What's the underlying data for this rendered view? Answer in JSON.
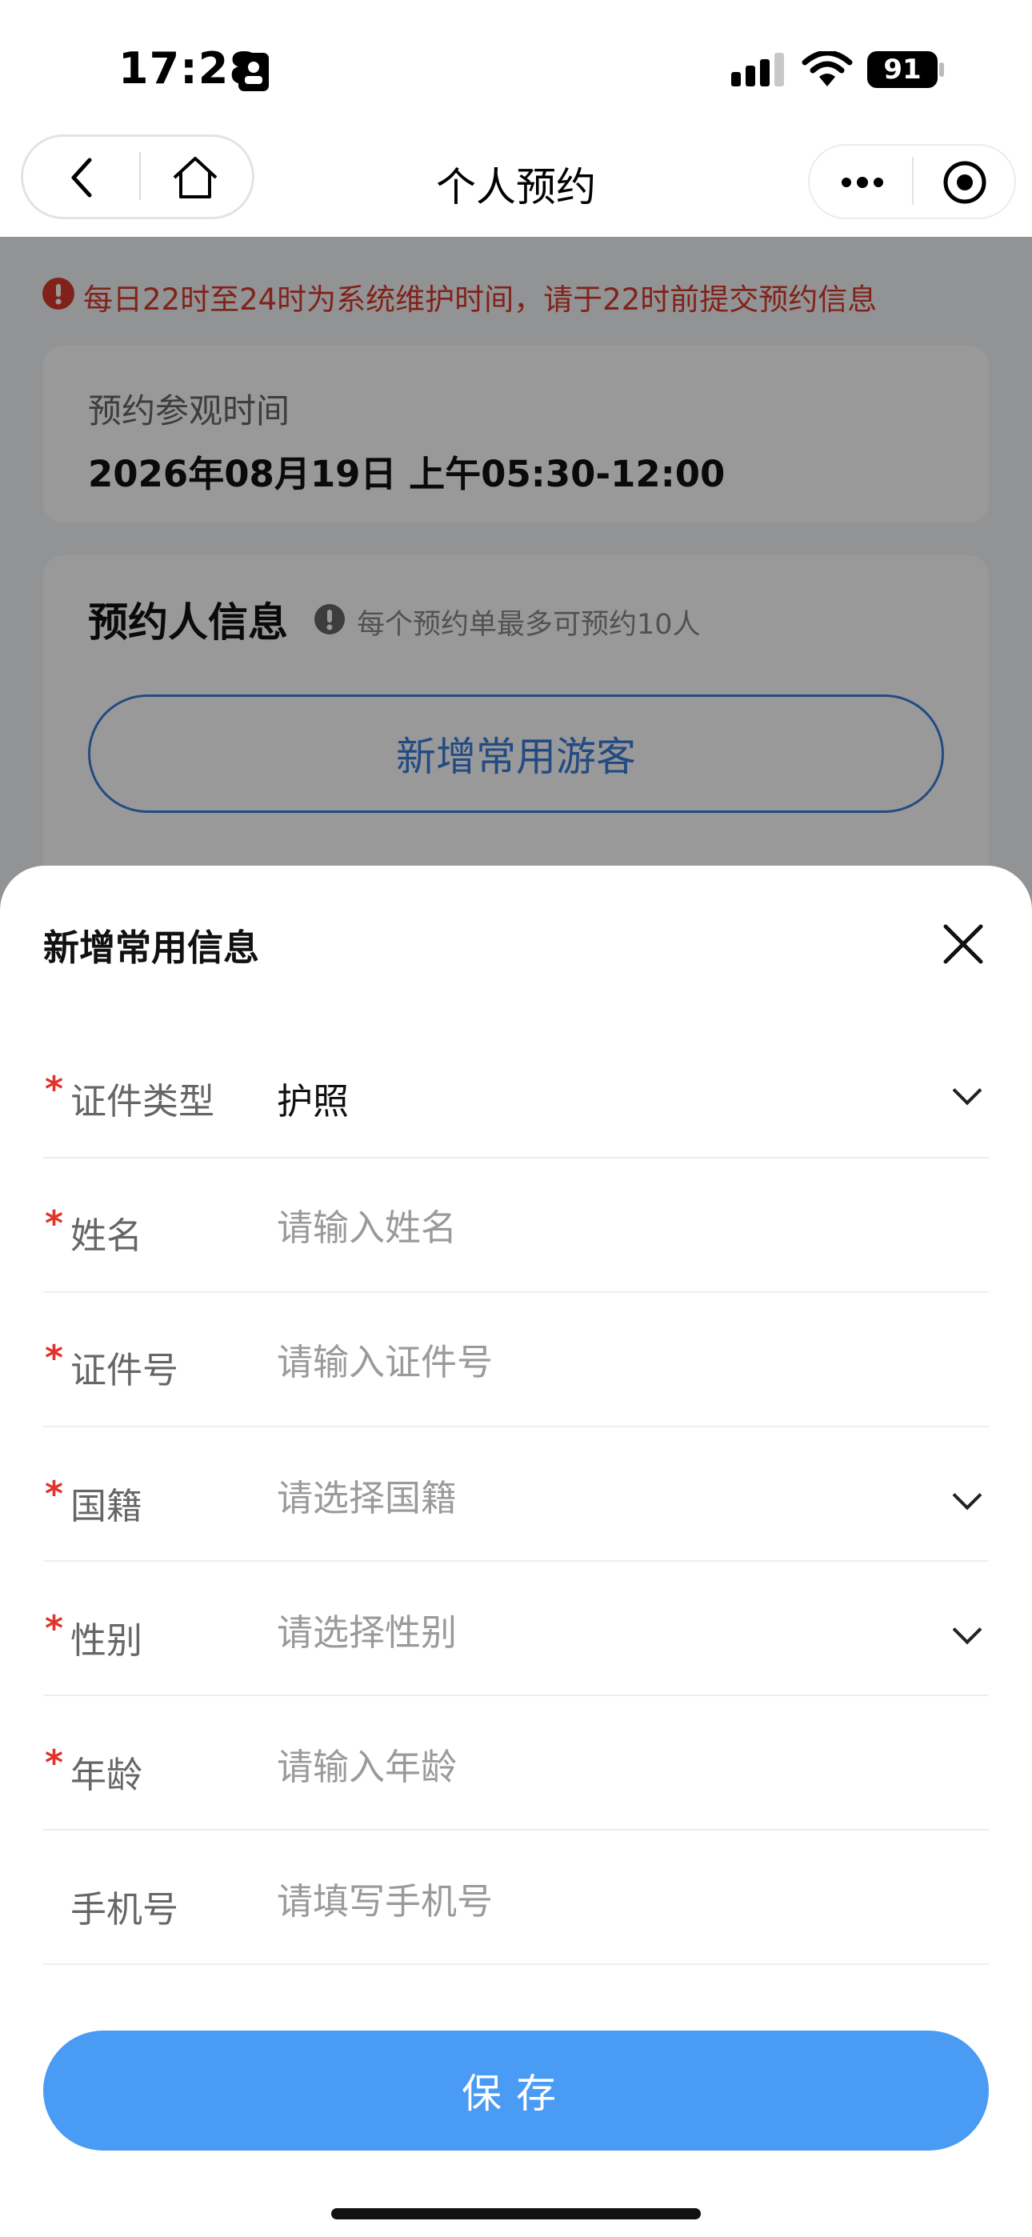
{
  "status_bar": {
    "time": "17:28",
    "battery": "91"
  },
  "nav": {
    "title": "个人预约"
  },
  "notice": {
    "text": "每日22时至24时为系统维护时间，请于22时前提交预约信息"
  },
  "visit": {
    "label": "预约参观时间",
    "value": "2026年08月19日 上午05:30-12:00"
  },
  "booker": {
    "title": "预约人信息",
    "tip": "每个预约单最多可预约10人",
    "add_label": "新增常用游客"
  },
  "sheet": {
    "title": "新增常用信息",
    "fields": [
      {
        "label": "证件类型",
        "required": "*",
        "value": "护照"
      },
      {
        "label": "姓名",
        "required": "*",
        "placeholder": "请输入姓名"
      },
      {
        "label": "证件号",
        "required": "*",
        "placeholder": "请输入证件号"
      },
      {
        "label": "国籍",
        "required": "*",
        "placeholder": "请选择国籍"
      },
      {
        "label": "性别",
        "required": "*",
        "placeholder": "请选择性别"
      },
      {
        "label": "年龄",
        "required": "*",
        "placeholder": "请输入年龄"
      },
      {
        "label": "手机号",
        "placeholder": "请填写手机号"
      }
    ],
    "save_label": "保存"
  },
  "colors": {
    "accent": "#4a9bf4",
    "link": "#3b7ddb",
    "warning": "#d83a2c"
  },
  "icons": [
    "back-icon",
    "home-icon",
    "more-icon",
    "target-icon",
    "warning-icon",
    "info-icon",
    "close-icon",
    "chevron-down-icon"
  ]
}
